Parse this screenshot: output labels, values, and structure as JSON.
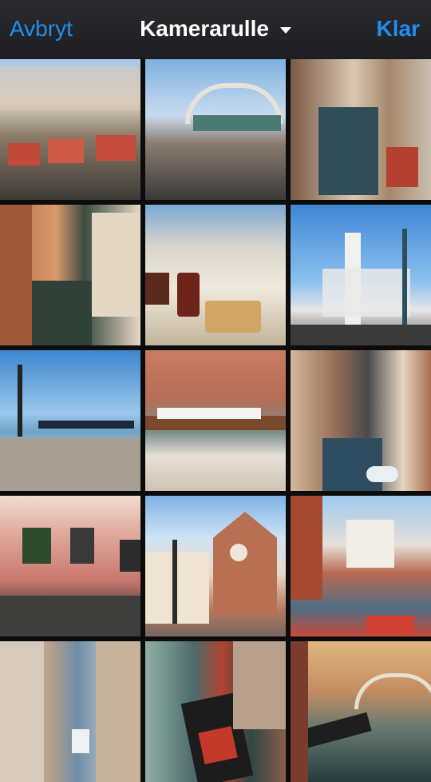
{
  "navbar": {
    "cancel_label": "Avbryt",
    "title": "Kamerarulle",
    "done_label": "Klar",
    "accent_color": "#1f8ef1",
    "title_icon": "chevron-down-icon"
  },
  "photos": [
    {
      "name": "photo-canal-cafe"
    },
    {
      "name": "photo-rialto-bridge"
    },
    {
      "name": "photo-narrow-canal"
    },
    {
      "name": "photo-orange-buildings-canal"
    },
    {
      "name": "photo-waffle-drink-table"
    },
    {
      "name": "photo-column-lamp-post"
    },
    {
      "name": "photo-lamp-post-gondolas"
    },
    {
      "name": "photo-rowing-boat"
    },
    {
      "name": "photo-canal-street"
    },
    {
      "name": "photo-pink-wall-windows"
    },
    {
      "name": "photo-church-facade"
    },
    {
      "name": "photo-canal-boats-church"
    },
    {
      "name": "photo-narrow-canal-gondola"
    },
    {
      "name": "photo-gondola-closeup"
    },
    {
      "name": "photo-canal-bridge-gondola"
    }
  ]
}
